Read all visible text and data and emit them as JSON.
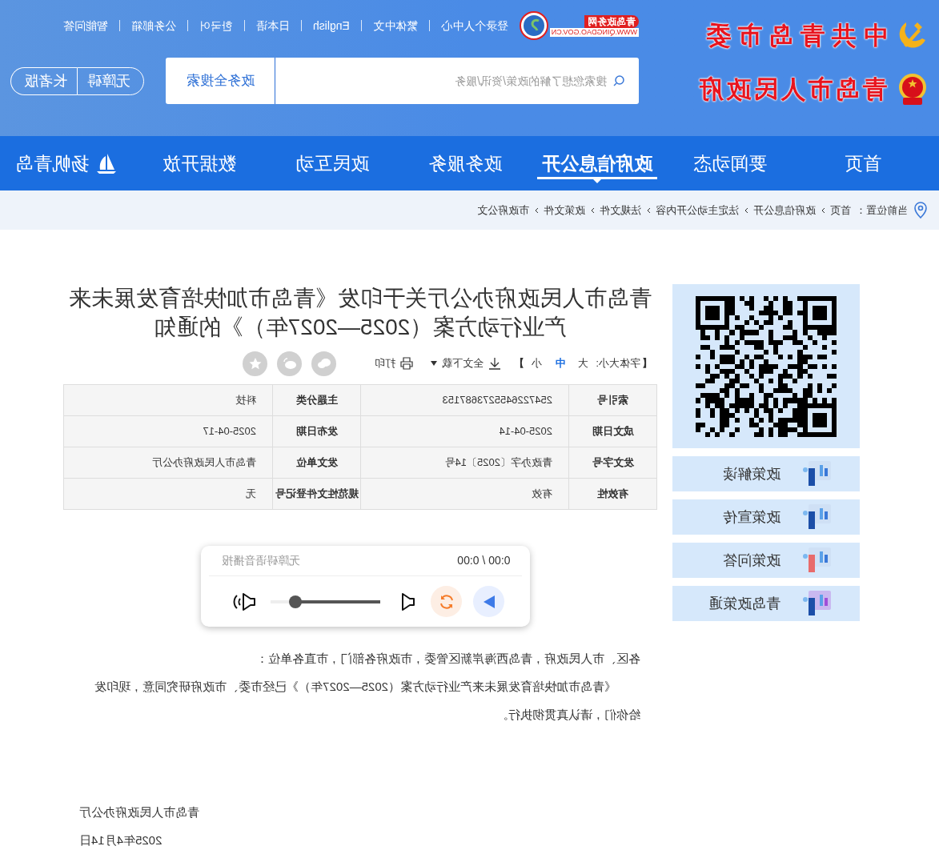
{
  "header": {
    "party_title": "中共青岛市委",
    "gov_title": "青岛市人民政府",
    "logo": {
      "name": "青岛政务网",
      "url": "WWW.QINGDAO.GOV.CN"
    },
    "top_links": [
      "智能问答",
      "公务邮箱",
      "한국어",
      "日本语",
      "English",
      "繁体中文",
      "登录个人中心"
    ],
    "search": {
      "button": "政务全搜索",
      "placeholder": "搜索您想了解的政策/资讯/服务"
    },
    "modes": [
      "长者版",
      "无障碍"
    ]
  },
  "nav": [
    {
      "label": "扬帆青岛",
      "selected": false
    },
    {
      "label": "数据开放",
      "selected": false
    },
    {
      "label": "政民互动",
      "selected": false
    },
    {
      "label": "政务服务",
      "selected": false
    },
    {
      "label": "政府信息公开",
      "selected": true
    },
    {
      "label": "要闻动态",
      "selected": false
    },
    {
      "label": "首页",
      "selected": false
    }
  ],
  "breadcrumb": {
    "items": [
      "市政府公文",
      "政策文件",
      "法规文件",
      "法定主动公开内容",
      "政府信息公开",
      "首页"
    ],
    "prefix": "当前位置："
  },
  "sidebar": {
    "items": [
      "政策解读",
      "政策宣传",
      "政策问答",
      "青岛政策通"
    ]
  },
  "article": {
    "title": "青岛市人民政府办公厅关于印发《青岛市加快培育发展未来产业行动方案（2025—2027年）》的通知",
    "font_size": {
      "close": "】",
      "sizes": [
        {
          "label": "小",
          "selected": false
        },
        {
          "label": "中",
          "selected": true
        },
        {
          "label": "大",
          "selected": false
        }
      ],
      "label": "字体大小:",
      "open": "【"
    },
    "print": "打印",
    "download": "全文下载",
    "meta": [
      [
        "科技",
        "主题分类",
        "2547226455273687153",
        "索引号"
      ],
      [
        "2025-04-17",
        "发布日期",
        "2025-04-14",
        "成文日期"
      ],
      [
        "青岛市人民政府办公厅",
        "发文单位",
        "青政办字〔2025〕14号",
        "发文字号"
      ],
      [
        "无",
        "规范性文件登记号",
        "有效",
        "有效性"
      ]
    ],
    "player": {
      "title": "无障碍语音播报",
      "time": "0:00 / 0:00",
      "volume": {
        "level": 0.78
      }
    },
    "salutation": "各区、市人民政府，青岛西海岸新区管委，市政府各部门，市直各单位：",
    "body": "《青岛市加快培育发展未来产业行动方案（2025—2027年）》已经市委、市政府研究同意，现印发给你们，请认真贯彻执行。",
    "signature": "青岛市人民政府办公厅",
    "date": "2025年4月14日"
  }
}
